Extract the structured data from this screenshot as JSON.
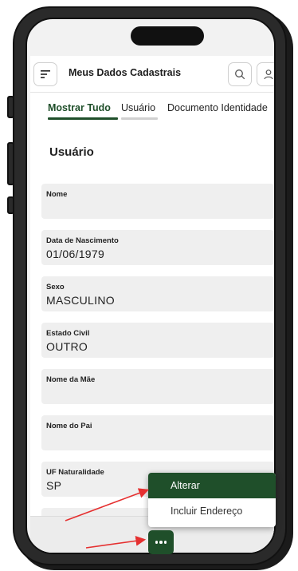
{
  "header": {
    "title": "Meus Dados Cadastrais",
    "menu_icon": "menu-icon",
    "search_icon": "search-icon",
    "user_icon": "user-icon"
  },
  "tabs": [
    {
      "label": "Mostrar Tudo",
      "active": true
    },
    {
      "label": "Usuário",
      "active": false
    },
    {
      "label": "Documento Identidade",
      "active": false
    }
  ],
  "section": {
    "title": "Usuário"
  },
  "fields": [
    {
      "label": "Nome",
      "value": ""
    },
    {
      "label": "Data de Nascimento",
      "value": "01/06/1979"
    },
    {
      "label": "Sexo",
      "value": "MASCULINO"
    },
    {
      "label": "Estado Civil",
      "value": "OUTRO"
    },
    {
      "label": "Nome da Mãe",
      "value": ""
    },
    {
      "label": "Nome do Pai",
      "value": ""
    },
    {
      "label": "UF Naturalidade",
      "value": "SP"
    }
  ],
  "popup_menu": {
    "items": [
      {
        "label": "Alterar",
        "selected": true
      },
      {
        "label": "Incluir Endereço",
        "selected": false
      }
    ]
  },
  "fab": {
    "icon": "more-horizontal-icon"
  },
  "colors": {
    "accent": "#1f4f2a",
    "arrow": "#e53030"
  }
}
